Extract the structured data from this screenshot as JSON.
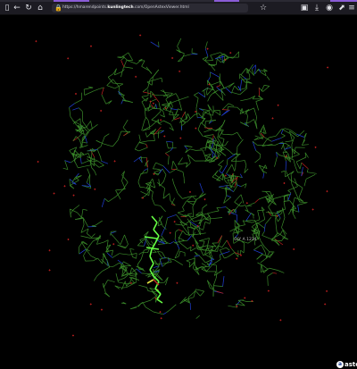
{
  "browser": {
    "url_prefix": "https://",
    "url_host_start": "hmarendpoints.",
    "url_domain": "kunlingtech",
    "url_rest": ".com/OpenAstexViewer.html",
    "icons": {
      "sidebar": "sidebar-icon",
      "back": "back-arrow-icon",
      "reload": "reload-icon",
      "home": "home-icon",
      "lock": "lock-icon",
      "bookmark": "bookmark-star-icon",
      "menu": "hamburger-menu-icon"
    }
  },
  "viewer": {
    "residue_label": "GLY A 1234",
    "brand_text": "astex",
    "colors": {
      "background": "#000000",
      "carbon": "#3a8a2a",
      "nitrogen": "#2040d8",
      "oxygen": "#c02020",
      "ligand": "#66ff44",
      "sulfur": "#e0e040"
    }
  }
}
